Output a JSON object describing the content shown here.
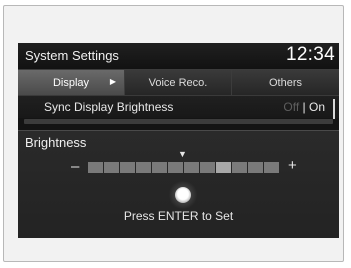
{
  "header": {
    "title": "System Settings",
    "clock": "12:34"
  },
  "tabs": [
    {
      "label": "Display",
      "active": true
    },
    {
      "label": "Voice Reco.",
      "active": false
    },
    {
      "label": "Others",
      "active": false
    }
  ],
  "setting": {
    "label": "Sync Display Brightness",
    "options": [
      "Off",
      "On"
    ],
    "separator": "|",
    "selected": "On"
  },
  "brightness": {
    "title": "Brightness",
    "minus_label": "–",
    "plus_label": "+",
    "indicator": "▼",
    "segment_count": 12,
    "current_level": 6,
    "highlighted_segment": 9,
    "hint": "Press ENTER to Set"
  },
  "colors": {
    "screen_bg": "#141414",
    "active_tab": "#5a5a5a",
    "text": "#e8e8e8",
    "inactive_option": "#5e5e5e"
  },
  "icons": [
    "tab-arrow-icon",
    "level-indicator-icon",
    "enter-knob-icon"
  ]
}
